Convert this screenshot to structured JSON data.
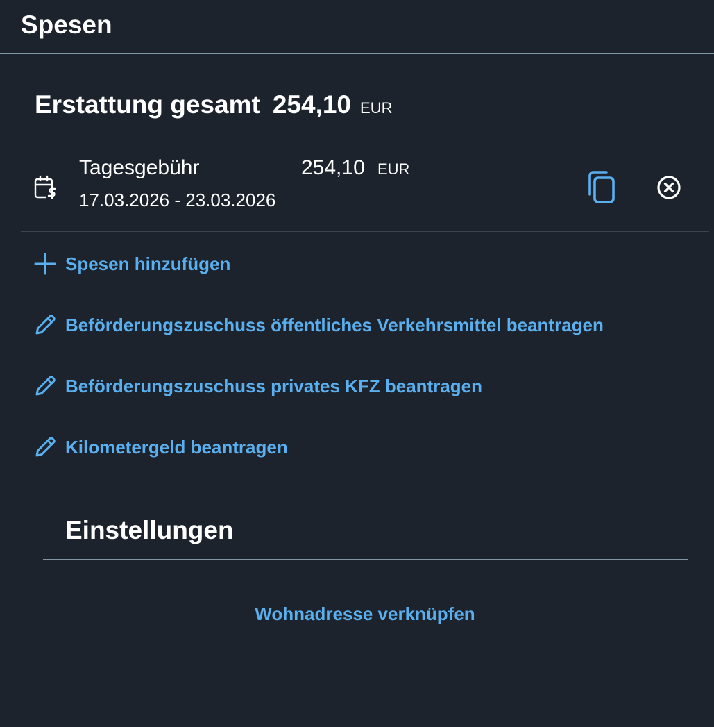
{
  "header": {
    "title": "Spesen"
  },
  "summary": {
    "label": "Erstattung gesamt",
    "amount": "254,10",
    "currency": "EUR"
  },
  "expense_item": {
    "icon": "calendar-money-icon",
    "name": "Tagesgebühr",
    "amount": "254,10",
    "currency": "EUR",
    "dates": "17.03.2026 - 23.03.2026"
  },
  "actions": [
    {
      "icon": "plus-icon",
      "label": "Spesen hinzufügen"
    },
    {
      "icon": "pencil-icon",
      "label": "Beförderungszuschuss öffentliches Verkehrsmittel beantragen"
    },
    {
      "icon": "pencil-icon",
      "label": "Beförderungszuschuss privates KFZ beantragen"
    },
    {
      "icon": "pencil-icon",
      "label": "Kilometergeld beantragen"
    }
  ],
  "settings": {
    "title": "Einstellungen",
    "link_label": "Wohnadresse verknüpfen"
  },
  "colors": {
    "background": "#1d232c",
    "accent": "#5aafef",
    "divider": "#8396a8"
  }
}
